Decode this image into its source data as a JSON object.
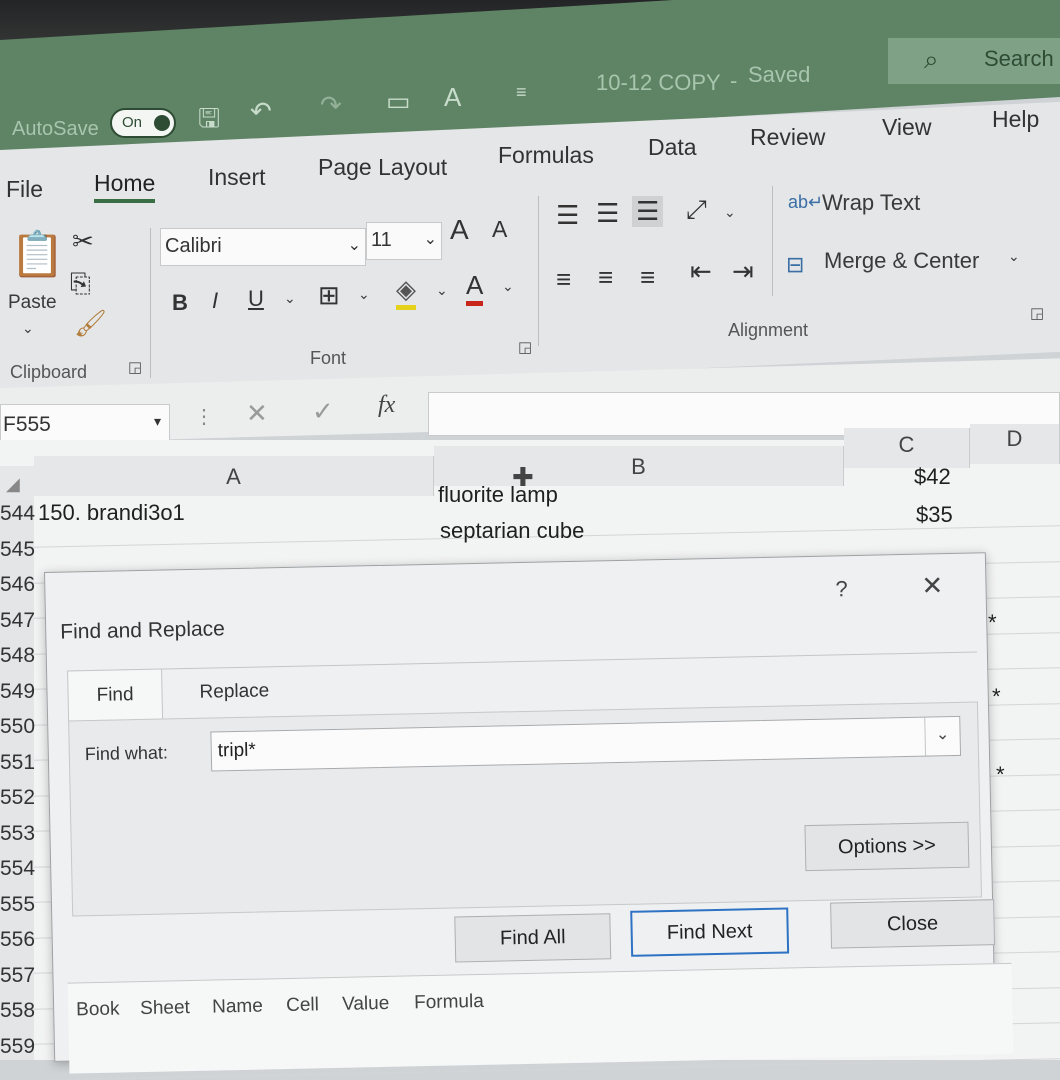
{
  "title_bar": {
    "autosave_label": "AutoSave",
    "autosave_state": "On",
    "filename": "10-12 COPY",
    "save_state": "Saved",
    "search_label": "Search"
  },
  "menu": {
    "file": "File",
    "home": "Home",
    "insert": "Insert",
    "page_layout": "Page Layout",
    "formulas": "Formulas",
    "data": "Data",
    "review": "Review",
    "view": "View",
    "help": "Help"
  },
  "ribbon": {
    "paste": "Paste",
    "clipboard_group": "Clipboard",
    "font_name": "Calibri",
    "font_size": "11",
    "bold": "B",
    "italic": "I",
    "underline": "U",
    "font_group": "Font",
    "wrap_text": "Wrap Text",
    "merge_center": "Merge & Center",
    "alignment_group": "Alignment",
    "grow_font": "A",
    "shrink_font": "A",
    "font_color": "A"
  },
  "formula_bar": {
    "name_box": "F555",
    "fx": "fx",
    "cancel": "✕",
    "enter": "✓",
    "value": ""
  },
  "sheet": {
    "columns": [
      "A",
      "B",
      "C",
      "D"
    ],
    "rows": [
      {
        "num": "544",
        "a": "150. brandi3o1",
        "b": "fluorite lamp",
        "c": "$42"
      },
      {
        "num": "545",
        "a": "",
        "b": "septarian cube",
        "c": "$35"
      },
      {
        "num": "546",
        "a": "",
        "b": "",
        "c": ""
      },
      {
        "num": "547",
        "a": "",
        "b": "",
        "c": ""
      },
      {
        "num": "548",
        "a": "",
        "b": "",
        "c": ""
      },
      {
        "num": "549",
        "a": "",
        "b": "",
        "c": ""
      },
      {
        "num": "550",
        "a": "",
        "b": "",
        "c": ""
      },
      {
        "num": "551",
        "a": "",
        "b": "",
        "c": ""
      },
      {
        "num": "552",
        "a": "",
        "b": "",
        "c": ""
      },
      {
        "num": "553",
        "a": "",
        "b": "",
        "c": ""
      },
      {
        "num": "554",
        "a": "",
        "b": "",
        "c": ""
      },
      {
        "num": "555",
        "a": "",
        "b": "",
        "c": ""
      },
      {
        "num": "556",
        "a": "",
        "b": "",
        "c": ""
      },
      {
        "num": "557",
        "a": "",
        "b": "",
        "c": ""
      },
      {
        "num": "558",
        "a": "",
        "b": "",
        "c": ""
      },
      {
        "num": "559",
        "a": "",
        "b": "",
        "c": ""
      }
    ],
    "star_marks": [
      "*",
      "*",
      "*"
    ]
  },
  "dialog": {
    "title": "Find and Replace",
    "help": "?",
    "close_x": "✕",
    "tabs": [
      "Find",
      "Replace"
    ],
    "find_what_label": "Find what:",
    "find_what_value": "tripl*",
    "options_button": "Options >>",
    "find_all_button": "Find All",
    "find_next_button": "Find Next",
    "close_button": "Close",
    "result_columns": [
      "Book",
      "Sheet",
      "Name",
      "Cell",
      "Value",
      "Formula"
    ]
  },
  "colors": {
    "title_green": "#5f8465",
    "accent_blue": "#2e72c4",
    "ribbon_bg": "#e4e6e7"
  }
}
